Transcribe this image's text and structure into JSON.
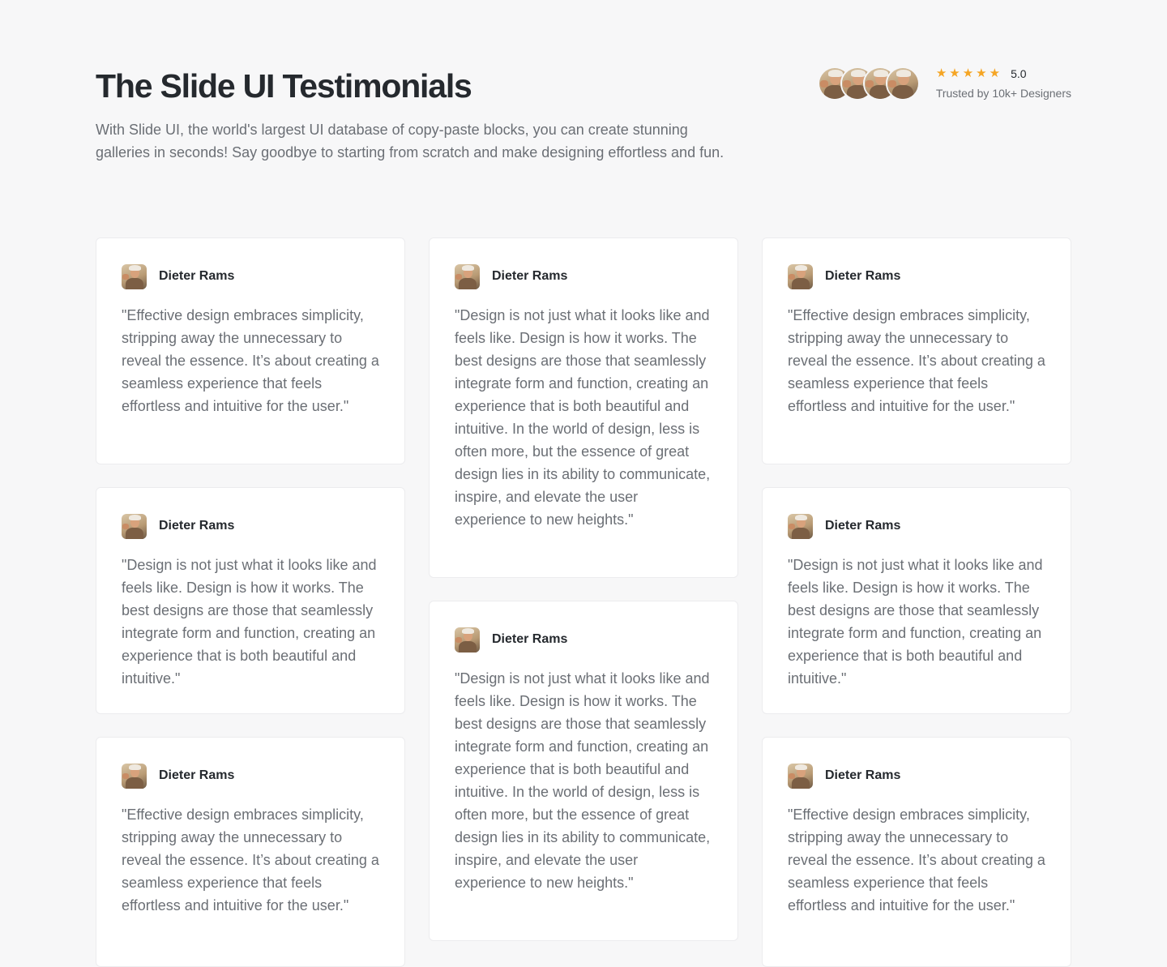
{
  "header": {
    "title": "The Slide UI Testimonials",
    "subtitle": "With Slide UI, the world's largest UI database of copy-paste blocks, you can create stunning galleries in seconds! Say goodbye to starting from scratch and make designing effortless and fun."
  },
  "rating": {
    "stars": 5,
    "value": "5.0",
    "trusted_text": "Trusted by 10k+ Designers",
    "star_color": "#f5a524"
  },
  "testimonials": [
    {
      "author": "Dieter Rams",
      "quote": "\"Effective design embraces simplicity, stripping away the unnecessary to reveal the essence. It’s about creating a seamless experience that feels effortless and intuitive for the user.\""
    },
    {
      "author": "Dieter Rams",
      "quote": "\"Design is not just what it looks like and feels like. Design is how it works. The best designs are those that seamlessly integrate form and function, creating an experience that is both beautiful and intuitive.\""
    },
    {
      "author": "Dieter Rams",
      "quote": "\"Effective design embraces simplicity, stripping away the unnecessary to reveal the essence. It’s about creating a seamless experience that feels effortless and intuitive for the user.\""
    },
    {
      "author": "Dieter Rams",
      "quote": "\"Design is not just what it looks like and feels like. Design is how it works. The best designs are those that seamlessly integrate form and function, creating an experience that is both beautiful and intuitive. In the world of design, less is often more, but the essence of great design lies in its ability to communicate, inspire, and elevate the user experience to new heights.\""
    },
    {
      "author": "Dieter Rams",
      "quote": "\"Design is not just what it looks like and feels like. Design is how it works. The best designs are those that seamlessly integrate form and function, creating an experience that is both beautiful and intuitive. In the world of design, less is often more, but the essence of great design lies in its ability to communicate, inspire, and elevate the user experience to new heights.\""
    },
    {
      "author": "Dieter Rams",
      "quote": "\"Effective design embraces simplicity, stripping away the unnecessary to reveal the essence. It’s about creating a seamless experience that feels effortless and intuitive for the user.\""
    },
    {
      "author": "Dieter Rams",
      "quote": "\"Design is not just what it looks like and feels like. Design is how it works. The best designs are those that seamlessly integrate form and function, creating an experience that is both beautiful and intuitive.\""
    },
    {
      "author": "Dieter Rams",
      "quote": "\"Effective design embraces simplicity, stripping away the unnecessary to reveal the essence. It’s about creating a seamless experience that feels effortless and intuitive for the user.\""
    }
  ]
}
